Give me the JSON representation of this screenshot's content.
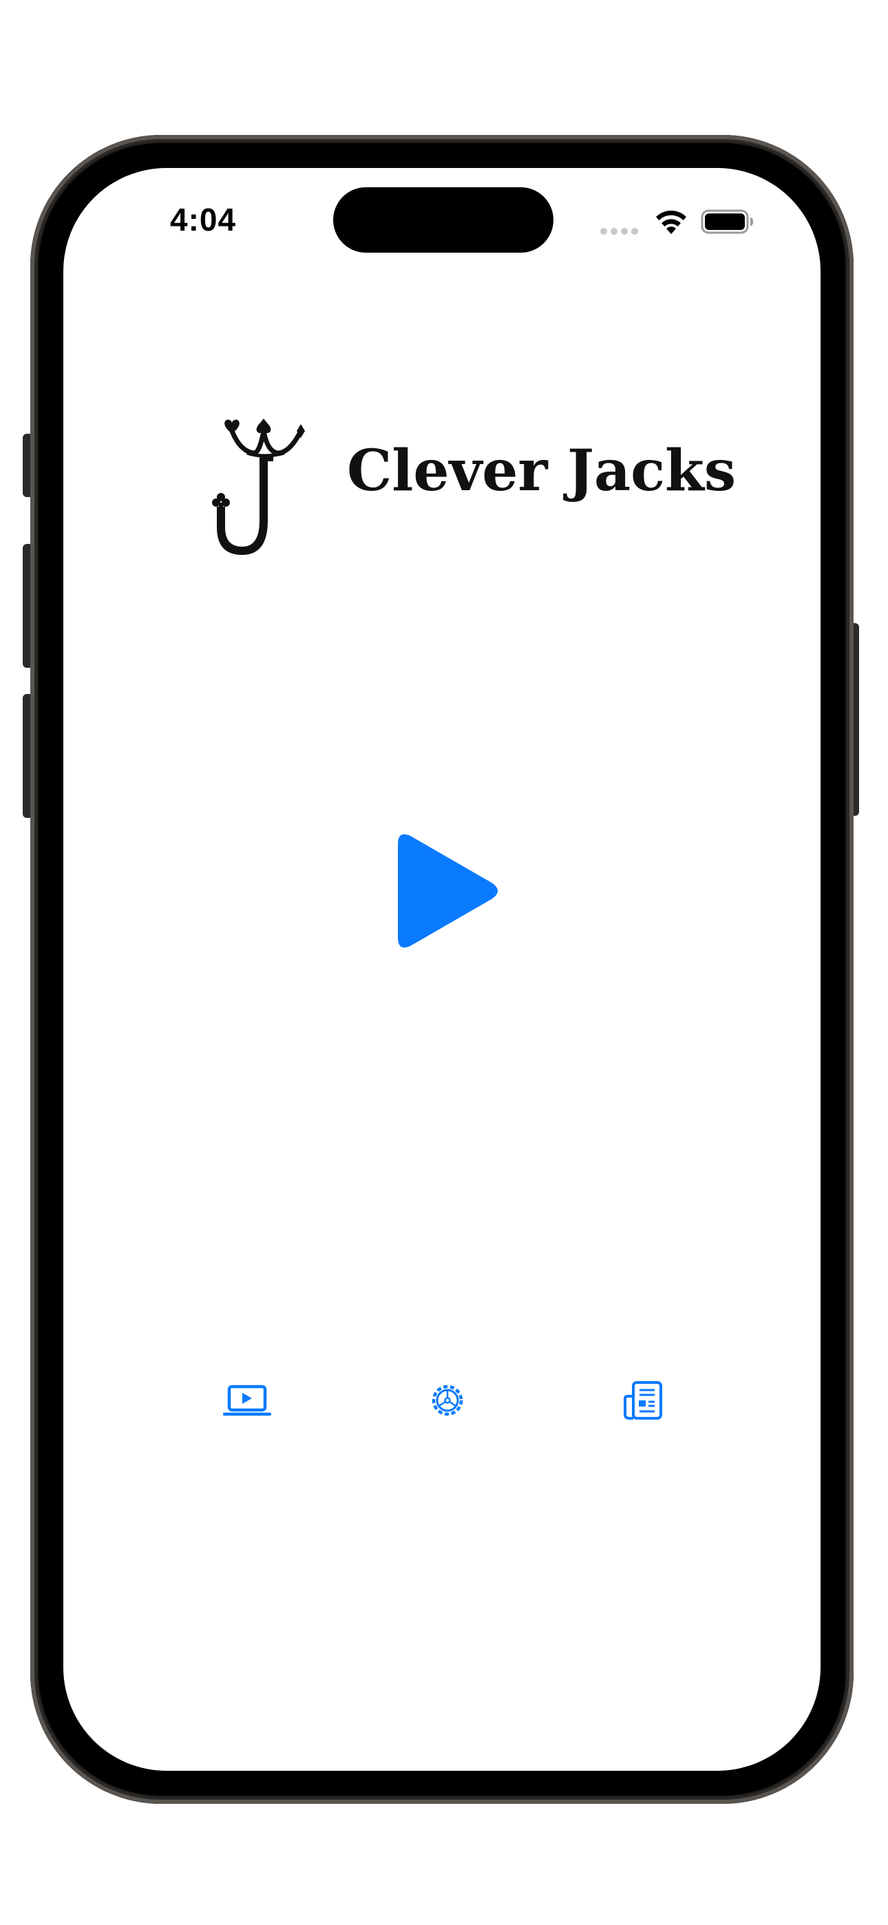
{
  "status_bar": {
    "time": "4:04"
  },
  "app": {
    "title": "Clever Jacks"
  },
  "icons": {
    "logo": "jack-crown-logo",
    "play": "play-icon",
    "tutorial": "laptop-play-icon",
    "settings": "gear-icon",
    "news": "newspaper-icon",
    "wifi": "wifi-icon",
    "battery": "battery-icon"
  },
  "colors": {
    "accent": "#0A7AFF",
    "text": "#111111",
    "background": "#FFFFFF",
    "frame": "#000000"
  }
}
